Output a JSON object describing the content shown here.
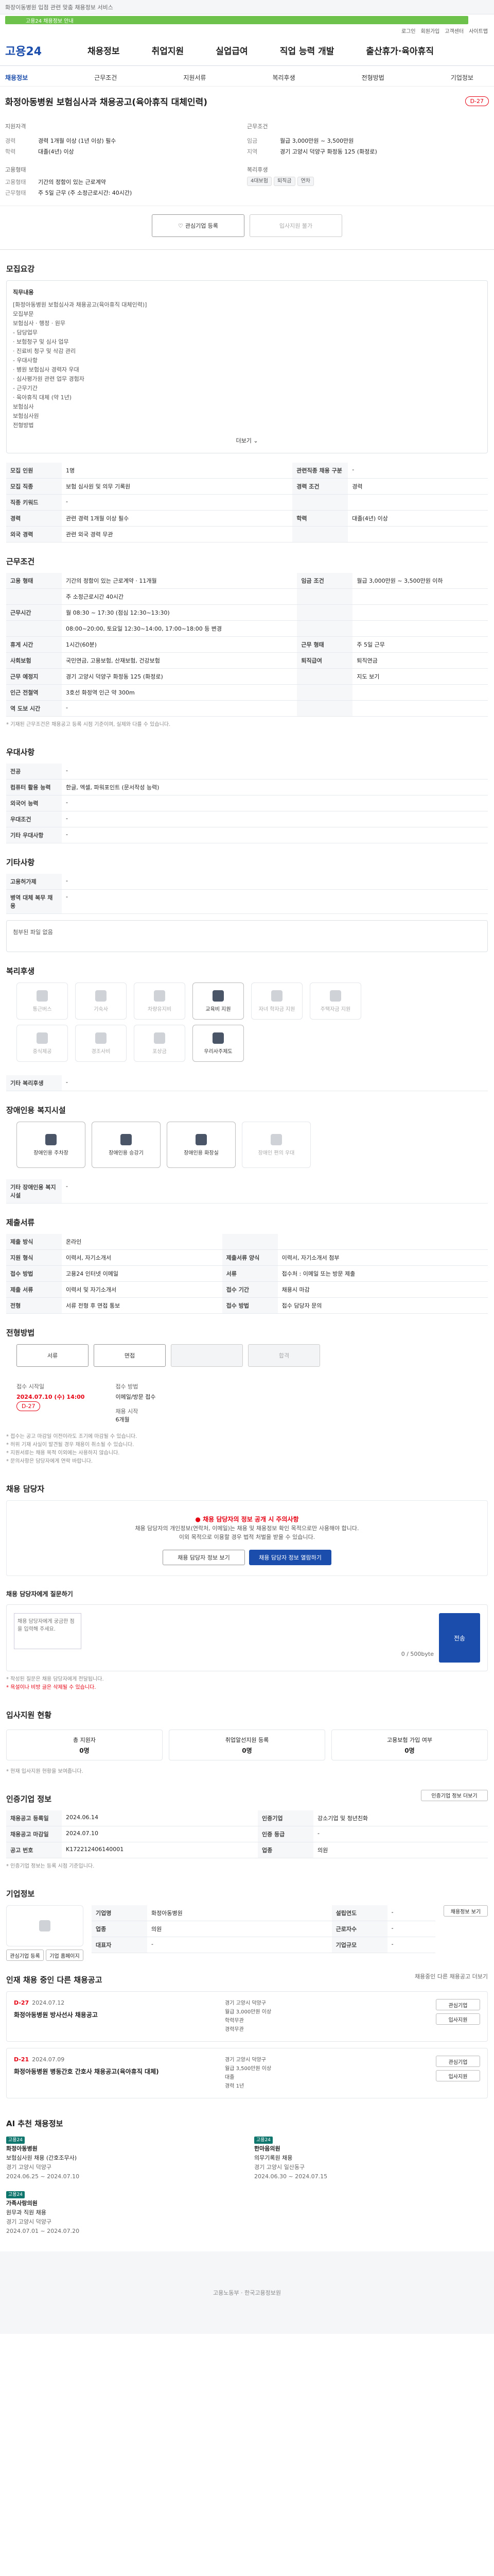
{
  "top": {
    "notice": "화장이동병원 입점 관련 맞춤 채용정보 서비스",
    "banner": "고용24 채용정보 안내",
    "util": [
      "로그인",
      "회원가입",
      "고객센터",
      "사이트맵"
    ]
  },
  "header": {
    "logo": "고용24",
    "gnb": [
      "채용정보",
      "취업지원",
      "실업급여",
      "직업 능력 개발",
      "출산휴가·육아휴직"
    ]
  },
  "tabs": [
    "채용정보",
    "근무조건",
    "지원서류",
    "복리후생",
    "전형방법",
    "기업정보"
  ],
  "job": {
    "title": "화정아동병원 보험심사과 채용공고(육아휴직 대체인력)",
    "dday": "D-27"
  },
  "summary": {
    "left_head": "지원자격",
    "left": [
      {
        "k": "경력",
        "v": "경력 1개월 이상 (1년 이상) 필수"
      },
      {
        "k": "학력",
        "v": "대졸(4년) 이상"
      }
    ],
    "mid_head": "고용형태",
    "mid": [
      {
        "k": "고용형태",
        "v": "기간의 정함이 있는 근로계약"
      },
      {
        "k": "근무형태",
        "v": "주 5일 근무 (주 소정근로시간: 40시간)"
      }
    ],
    "right_head": "근무조건",
    "right": [
      {
        "k": "임금",
        "v": "월급 3,000만원 ~ 3,500만원"
      },
      {
        "k": "지역",
        "v": "경기 고양시 덕양구 화정동 125 (화정로)"
      }
    ],
    "right2_head": "복리후생",
    "right2": [
      "4대보험",
      "퇴직금",
      "연차"
    ]
  },
  "buttons": {
    "interest": "관심기업 등록",
    "apply": "입사지원 불가"
  },
  "recruit": {
    "heading": "모집요강",
    "box_head": "직무내용",
    "box_lines": [
      "[화정아동병원 보험심사과 채용공고(육아휴직 대체인력)]",
      "모집부문",
      "보험심사 · 행정 · 원무",
      "- 담당업무",
      "· 보험청구 및 심사 업무",
      "· 진료비 청구 및 삭감 관리",
      "- 우대사항",
      "· 병원 보험심사 경력자 우대",
      "· 심사평가원 관련 업무 경험자",
      "- 근무기간",
      "· 육아휴직 대체 (약 1년)",
      "보험심사",
      "보험심사원",
      "전형방법"
    ],
    "more": "더보기",
    "rows": [
      {
        "k": "모집 인원",
        "v": "1명",
        "k2": "관련직종 채용 구분",
        "v2": "-"
      },
      {
        "k": "모집 직종",
        "v": "보험 심사원 및 의무 기록원",
        "k2": "경력 조건",
        "v2": "경력"
      },
      {
        "k": "직종 키워드",
        "v": "-",
        "k2": "",
        "v2": ""
      },
      {
        "k": "경력",
        "v": "관련 경력 1개월 이상 필수",
        "k2": "학력",
        "v2": "대졸(4년) 이상"
      },
      {
        "k": "외국 경력",
        "v": "관련 외국 경력 무관",
        "k2": "",
        "v2": ""
      }
    ]
  },
  "work": {
    "heading": "근무조건",
    "rows": [
      {
        "k": "고용 형태",
        "v": "기간의 정함이 있는 근로계약 · 11개월",
        "k2": "임금 조건",
        "v2": "월급 3,000만원 ~ 3,500만원 이하"
      },
      {
        "k": "",
        "v": "주 소정근로시간 40시간",
        "k2": "",
        "v2": ""
      },
      {
        "k": "근무시간",
        "v": "월 08:30 ~ 17:30 (점심 12:30~13:30)",
        "k2": "",
        "v2": ""
      },
      {
        "k": "",
        "v": "08:00~20:00, 토요일 12:30~14:00, 17:00~18:00 등 변경",
        "k2": "",
        "v2": ""
      },
      {
        "k": "휴게 시간",
        "v": "1시간(60분)",
        "k2": "근무 형태",
        "v2": "주 5일 근무"
      },
      {
        "k": "사회보험",
        "v": "국민연금, 고용보험, 산재보험, 건강보험",
        "k2": "퇴직급여",
        "v2": "퇴직연금"
      },
      {
        "k": "근무 예정지",
        "v": "경기 고양시 덕양구 화정동 125 (화정로)",
        "k2": "",
        "v2": "지도 보기"
      },
      {
        "k": "인근 전철역",
        "v": "3호선 화정역 인근 약 300m",
        "k2": "",
        "v2": ""
      },
      {
        "k": "역 도보 시간",
        "v": "-",
        "k2": "",
        "v2": ""
      }
    ],
    "note": "* 기재된 근무조건은 채용공고 등록 시점 기준이며, 실제와 다를 수 있습니다."
  },
  "extra": {
    "heading": "우대사항",
    "rows": [
      {
        "k": "전공",
        "v": "-"
      },
      {
        "k": "컴퓨터 활용 능력",
        "v": "한글, 엑셀, 파워포인트 (문서작성 능력)"
      },
      {
        "k": "외국어 능력",
        "v": "-"
      },
      {
        "k": "우대조건",
        "v": "-"
      },
      {
        "k": "기타 우대사항",
        "v": "-"
      }
    ]
  },
  "etc": {
    "heading": "기타사항",
    "rows": [
      {
        "k": "고용허가제",
        "v": "-"
      },
      {
        "k": "병역 대체 복무 채용",
        "v": "-"
      }
    ],
    "attach": "첨부된 파일 없음"
  },
  "welfare": {
    "heading": "복리후생",
    "items": [
      {
        "label": "통근버스",
        "on": false
      },
      {
        "label": "기숙사",
        "on": false
      },
      {
        "label": "차량유지비",
        "on": false
      },
      {
        "label": "교육비 지원",
        "on": true
      },
      {
        "label": "자녀 학자금 지원",
        "on": false
      },
      {
        "label": "주택자금 지원",
        "on": false
      },
      {
        "label": "중식제공",
        "on": false
      },
      {
        "label": "경조사비",
        "on": false
      },
      {
        "label": "포상금",
        "on": false
      },
      {
        "label": "우리사주제도",
        "on": true
      }
    ],
    "other": "기타 복리후생",
    "other_v": "-"
  },
  "disabled": {
    "heading": "장애인용 복지시설",
    "items": [
      {
        "label": "장애인용 주차장",
        "on": true
      },
      {
        "label": "장애인용 승강기",
        "on": true
      },
      {
        "label": "장애인용 화장실",
        "on": true
      },
      {
        "label": "장애인 편의 우대",
        "on": false
      }
    ],
    "other": "기타 장애인용 복지시설",
    "other_v": "-"
  },
  "docs": {
    "heading": "제출서류",
    "rows": [
      {
        "k": "제출 방식",
        "v": "온라인",
        "k2": "",
        "v2": ""
      },
      {
        "k": "지원 형식",
        "v": "이력서, 자기소개서",
        "k2": "제출서류 양식",
        "v2": "이력서, 자기소개서 첨부"
      },
      {
        "k": "접수 방법",
        "v": "고용24 인터넷 이메일",
        "k2": "서류",
        "v2": "접수처 : 이메일 또는 방문 제출"
      },
      {
        "k": "제출 서류",
        "v": "이력서 및 자기소개서",
        "k2": "접수 기간",
        "v2": "채용시 마감"
      },
      {
        "k": "전형",
        "v": "서류 전형 후 면접 통보",
        "k2": "접수 방법",
        "v2": "접수 담당자 문의"
      }
    ]
  },
  "process": {
    "heading": "전형방법",
    "steps": [
      "서류",
      "면접",
      "",
      "합격"
    ],
    "start_label": "접수 시작일",
    "start": "2024.07.10 (수) 14:00",
    "end_label": "접수 방법",
    "end": "이메일/방문 접수",
    "dday": "D-27",
    "method_label": "채용 시작",
    "method": "6개월"
  },
  "notice": [
    "* 접수는 공고 마감일 이전이라도 조기에 마감될 수 있습니다.",
    "* 허위 기재 사실이 발견될 경우 채용이 취소될 수 있습니다.",
    "* 지원서류는 채용 목적 이외에는 사용하지 않습니다.",
    "* 문의사항은 담당자에게 연락 바랍니다."
  ],
  "contact": {
    "heading": "채용 담당자",
    "alert": "채용 담당자의 정보 공개 시 주의사항",
    "alert_sub": [
      "채용 담당자의 개인정보(연락처, 이메일)는 채용 및 채용정보 확인 목적으로만 사용해야 합니다.",
      "이외 목적으로 이용할 경우 법적 처벌을 받을 수 있습니다."
    ],
    "btn1": "채용 담당자 정보 보기",
    "btn2": "채용 담당자 정보 열람하기"
  },
  "ask": {
    "heading": "채용 담당자에게 질문하기",
    "placeholder": "채용 담당자에게 궁금한 점을 입력해 주세요.",
    "count": "0 / 500byte",
    "send": "전송",
    "note1": "* 작성된 질문은 채용 담당자에게 전달됩니다.",
    "note2": "* 욕설이나 비방 글은 삭제될 수 있습니다."
  },
  "applystatus": {
    "heading": "입사지원 현황",
    "items": [
      {
        "label": "총 지원자",
        "value": "0명"
      },
      {
        "label": "취업알선지원 등록",
        "value": "0명"
      },
      {
        "label": "고용보험 가입 여부",
        "value": "0명"
      }
    ],
    "note": "* 현재 입사지원 현황을 보여줍니다."
  },
  "info": {
    "heading": "인증기업 정보",
    "sub": "인증기업 정보 더보기",
    "rows": [
      {
        "k": "채용공고 등록일",
        "v": "2024.06.14",
        "k2": "인증기업",
        "v2": "강소기업 및 청년친화"
      },
      {
        "k": "채용공고 마감일",
        "v": "2024.07.10",
        "k2": "인증 등급",
        "v2": "-"
      },
      {
        "k": "공고 번호",
        "v": "K172212406140001",
        "k2": "업종",
        "v2": "의원"
      }
    ],
    "note": "* 인증기업 정보는 등록 시점 기준입니다."
  },
  "company": {
    "heading": "기업정보",
    "rows": [
      {
        "k": "기업명",
        "v": "화정아동병원",
        "k2": "설립연도",
        "v2": "-"
      },
      {
        "k": "업종",
        "v": "의원",
        "k2": "근로자수",
        "v2": "-"
      },
      {
        "k": "대표자",
        "v": "-",
        "k2": "기업규모",
        "v2": "-"
      }
    ],
    "btn": "채용정보 보기",
    "b1": "관심기업 등록",
    "b2": "기업 홈페이지"
  },
  "others": {
    "heading": "인재 채용 중인 다른 채용공고",
    "sub": "채용중인 다른 채용공고 더보기",
    "cards": [
      {
        "dday": "D-27",
        "date": "2024.07.12",
        "title": "화정아동병원 방사선사 채용공고",
        "loc": "경기 고양시 덕양구",
        "pay": "월급 3,000만원 이상",
        "edu": "학력무관",
        "exp": "경력무관",
        "b1": "관심기업",
        "b2": "입사지원"
      },
      {
        "dday": "D-21",
        "date": "2024.07.09",
        "title": "화정아동병원 병동간호 간호사 채용공고(육아휴직 대체)",
        "loc": "경기 고양시 덕양구",
        "pay": "월급 3,500만원 이상",
        "edu": "대졸",
        "exp": "경력 1년",
        "b1": "관심기업",
        "b2": "입사지원"
      }
    ]
  },
  "reco": {
    "heading": "AI 추천 채용정보",
    "items": [
      {
        "tag": "고용24",
        "title": "화정아동병원",
        "sub": "보험심사원 채용 (간호조무사)",
        "addr": "경기 고양시 덕양구",
        "date": "2024.06.25 ~ 2024.07.10"
      },
      {
        "tag": "고용24",
        "title": "한마음의원",
        "sub": "의무기록원 채용",
        "addr": "경기 고양시 일산동구",
        "date": "2024.06.30 ~ 2024.07.15"
      },
      {
        "tag": "고용24",
        "title": "가족사랑의원",
        "sub": "원무과 직원 채용",
        "addr": "경기 고양시 덕양구",
        "date": "2024.07.01 ~ 2024.07.20"
      }
    ]
  },
  "footer": "고용노동부 · 한국고용정보원"
}
